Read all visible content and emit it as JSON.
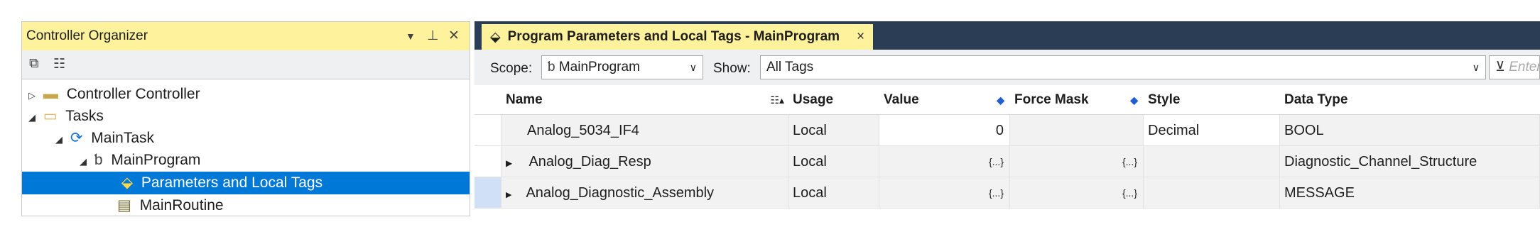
{
  "organizer": {
    "title": "Controller Organizer",
    "title_icons": [
      "dropdown-arrow-icon",
      "pin-icon",
      "close-icon"
    ],
    "toolbar_icons": [
      "collapse-all-icon",
      "expand-all-icon"
    ],
    "tree": [
      {
        "label": "Controller Controller",
        "icon": "folder-icon",
        "level": 0,
        "expanded": false,
        "selected": false
      },
      {
        "label": "Tasks",
        "icon": "folder-icon",
        "level": 0,
        "expanded": true,
        "selected": false
      },
      {
        "label": "MainTask",
        "icon": "task-icon",
        "level": 1,
        "expanded": true,
        "selected": false
      },
      {
        "label": "MainProgram",
        "icon": "program-icon",
        "level": 2,
        "expanded": true,
        "selected": false
      },
      {
        "label": "Parameters and Local Tags",
        "icon": "tag-icon",
        "level": 3,
        "expanded": null,
        "selected": true
      },
      {
        "label": "MainRoutine",
        "icon": "routine-icon",
        "level": 3,
        "expanded": null,
        "selected": false
      }
    ]
  },
  "editor": {
    "tab_title": "Program Parameters and Local Tags - MainProgram",
    "tab_close": "×",
    "scope_label": "Scope:",
    "scope_value": "MainProgram",
    "show_label": "Show:",
    "show_value": "All Tags",
    "filter_placeholder": "Enter Name Filter...",
    "columns": {
      "name": "Name",
      "usage": "Usage",
      "value": "Value",
      "force_mask": "Force Mask",
      "style": "Style",
      "data_type": "Data Type"
    },
    "rows": [
      {
        "name": "Analog_5034_IF4",
        "usage": "Local",
        "value": "0",
        "force_mask": "",
        "style": "Decimal",
        "data_type": "BOOL",
        "expandable": false
      },
      {
        "name": "Analog_Diag_Resp",
        "usage": "Local",
        "value": "{...}",
        "force_mask": "{...}",
        "style": "",
        "data_type": "Diagnostic_Channel_Structure",
        "expandable": true
      },
      {
        "name": "Analog_Diagnostic_Assembly",
        "usage": "Local",
        "value": "{...}",
        "force_mask": "{...}",
        "style": "",
        "data_type": "MESSAGE",
        "expandable": true
      }
    ]
  }
}
